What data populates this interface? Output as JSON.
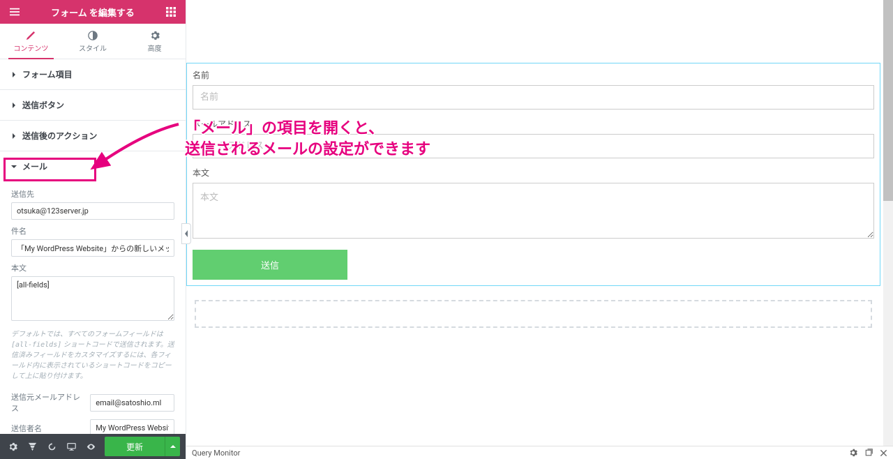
{
  "colors": {
    "accent": "#d6336c",
    "green": "#39b54a",
    "highlight": "#e6007e",
    "canvasBorder": "#71d7f7"
  },
  "header": {
    "title": "フォーム を編集する"
  },
  "tabs": {
    "content": "コンテンツ",
    "style": "スタイル",
    "advanced": "高度"
  },
  "sections": {
    "form_fields": "フォーム項目",
    "submit_button": "送信ボタン",
    "after_submit": "送信後のアクション",
    "email": "メール"
  },
  "mail": {
    "to_label": "送信先",
    "to_value": "otsuka@123server.jp",
    "subject_label": "件名",
    "subject_value": "「My WordPress Website」からの新しいメッセージ",
    "body_label": "本文",
    "body_value": "[all-fields]",
    "hint_pre": "デフォルトでは、すべてのフォームフィールドは",
    "hint_code": "[all-fields]",
    "hint_post": " ショートコードで送信されます。送信済みフィールドをカスタマイズするには、各フィールド内に表示されているショートコードをコピーして上に貼り付けます。",
    "from_label": "送信元メールアドレス",
    "from_value": "email@satoshio.ml",
    "from_name_label": "送信者名",
    "from_name_value": "My WordPress Website"
  },
  "footer": {
    "update": "更新"
  },
  "preview": {
    "name_label": "名前",
    "name_placeholder": "名前",
    "email_label": "メールアドレス",
    "email_placeholder": "メールアドレス",
    "message_label": "本文",
    "message_placeholder": "本文",
    "submit": "送信"
  },
  "statusbar": {
    "query_monitor": "Query Monitor"
  },
  "annotation": {
    "line1": "「メール」の項目を開くと、",
    "line2": "送信されるメールの設定ができます"
  }
}
